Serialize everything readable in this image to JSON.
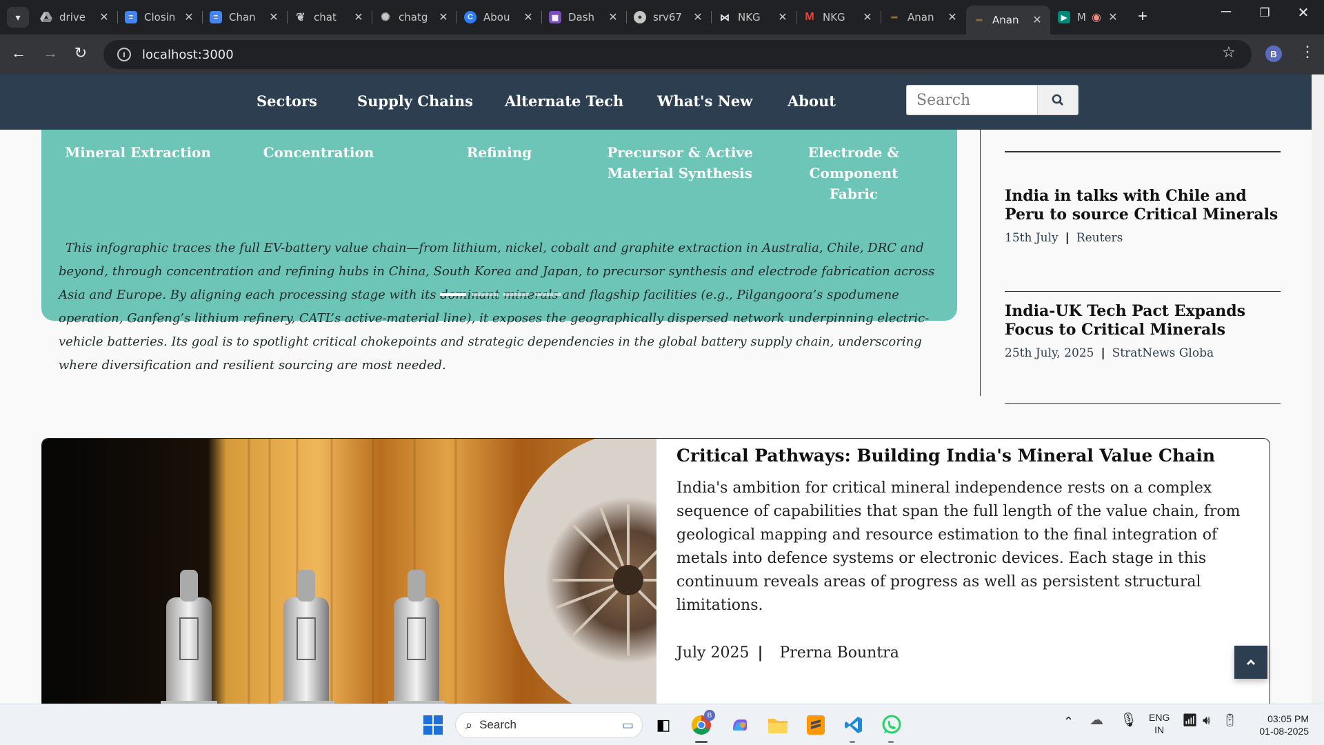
{
  "browser": {
    "tabs": [
      {
        "title": "drive",
        "icon": "google-drive-icon",
        "color": "#9aa0a6"
      },
      {
        "title": "Closin",
        "icon": "google-docs-icon",
        "color": "#4285f4"
      },
      {
        "title": "Chan",
        "icon": "google-docs-icon",
        "color": "#4285f4"
      },
      {
        "title": "chat",
        "icon": "openai-chat-icon",
        "color": "#c4c7c5"
      },
      {
        "title": "chatg",
        "icon": "openai-icon",
        "color": "#c4c7c5"
      },
      {
        "title": "Abou",
        "icon": "canva-c-icon",
        "color": "#2d7df6"
      },
      {
        "title": "Dash",
        "icon": "dashboard-icon",
        "color": "#7b4cc2"
      },
      {
        "title": "srv67",
        "icon": "server-icon",
        "color": "#c4c7c5"
      },
      {
        "title": "NKG",
        "icon": "bowtie-icon",
        "color": "#111"
      },
      {
        "title": "NKG",
        "icon": "gmail-icon",
        "color": "#ea4335"
      },
      {
        "title": "Anan",
        "icon": "site-icon",
        "color": "#8a6d3b"
      },
      {
        "title": "Anan",
        "icon": "site-icon",
        "color": "#8a6d3b",
        "active": true
      },
      {
        "title": "M",
        "icon": "meet-icon",
        "color": "#00897b"
      }
    ],
    "url": "localhost:3000",
    "profile_initial": "B"
  },
  "nav": {
    "links": [
      "Sectors",
      "Supply Chains",
      "Alternate Tech",
      "What's New",
      "About"
    ],
    "search_placeholder": "Search"
  },
  "infographic": {
    "stages": [
      "Mineral Extraction",
      "Concentration",
      "Refining",
      "Precursor & Active Material Synthesis",
      "Electrode & Component Fabric"
    ],
    "description": "This infographic traces the full EV-battery value chain—from lithium, nickel, cobalt and graphite extraction in Australia, Chile, DRC and beyond, through concentration and refining hubs in China, South Korea and Japan, to precursor synthesis and electrode fabrication across Asia and Europe. By aligning each processing stage with its dominant minerals and flagship facilities (e.g., Pilgangoora’s spodumene operation, Ganfeng’s lithium refinery, CATL’s active-material line), it exposes the geographically dispersed network underpinning electric-vehicle batteries. Its goal is to spotlight critical chokepoints and strategic dependencies in the global battery supply chain, underscoring where diversification and resilient sourcing are most needed.",
    "slides": 4,
    "active_slide": 1
  },
  "news": [
    {
      "title": "India in talks with Chile and Peru to source Critical Minerals",
      "date": "15th July",
      "source": "Reuters"
    },
    {
      "title": "India-UK Tech Pact Expands Focus to Critical Minerals",
      "date": "25th July, 2025",
      "source": "StratNews Globa"
    }
  ],
  "feature": {
    "title": "Critical Pathways: Building India's Mineral Value Chain",
    "body": "India's ambition for critical mineral independence rests on a complex sequence of capabilities that span the full length of the value chain, from geological mapping and resource estimation to the final integration of metals into defence systems or electronic devices. Each stage in this continuum reveals areas of progress as well as persistent structural limitations.",
    "date": "July 2025",
    "author": "Prerna Bountra"
  },
  "taskbar": {
    "search_label": "Search",
    "lang_line1": "ENG",
    "lang_line2": "IN",
    "time": "03:05 PM",
    "date": "01-08-2025",
    "chrome_badge": "B"
  },
  "colors": {
    "nav_bg": "#2c3e50",
    "infographic_bg": "#6cc5b7"
  }
}
